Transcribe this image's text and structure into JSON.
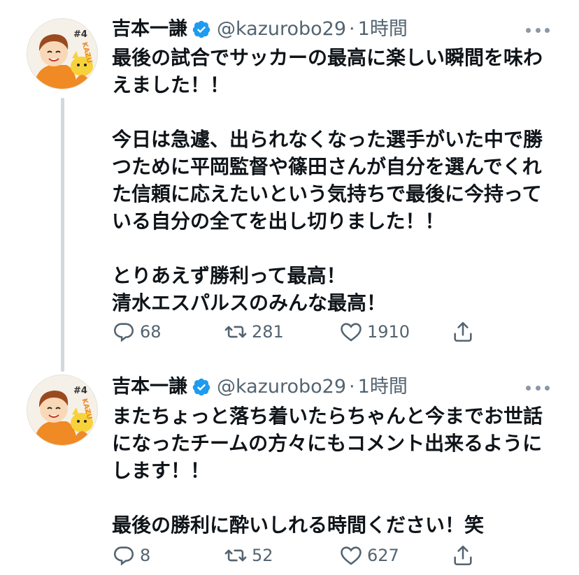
{
  "tweets": [
    {
      "author_name": "吉本一謙",
      "handle": "@kazurobo29",
      "separator": "·",
      "time": "1時間",
      "text": "最後の試合でサッカーの最高に楽しい瞬間を味わえました！！\n\n今日は急遽、出られなくなった選手がいた中で勝つために平岡監督や篠田さんが自分を選んでくれた信頼に応えたいという気持ちで最後に今持っている自分の全てを出し切りました！！\n\nとりあえず勝利って最高！\n清水エスパルスのみんな最高！",
      "replies": "68",
      "retweets": "281",
      "likes": "1910",
      "avatar_text": "#4 KAZU"
    },
    {
      "author_name": "吉本一謙",
      "handle": "@kazurobo29",
      "separator": "·",
      "time": "1時間",
      "text": "またちょっと落ち着いたらちゃんと今までお世話になったチームの方々にもコメント出来るようにします！！\n\n最後の勝利に酔いしれる時間ください！笑",
      "replies": "8",
      "retweets": "52",
      "likes": "627",
      "avatar_text": "#4 KAZU"
    }
  ],
  "colors": {
    "verified": "#1d9bf0",
    "secondary_text": "#536471",
    "thread_line": "#cfd9de"
  },
  "icons": [
    "verified-badge-icon",
    "reply-icon",
    "retweet-icon",
    "like-icon",
    "share-icon",
    "more-icon"
  ]
}
